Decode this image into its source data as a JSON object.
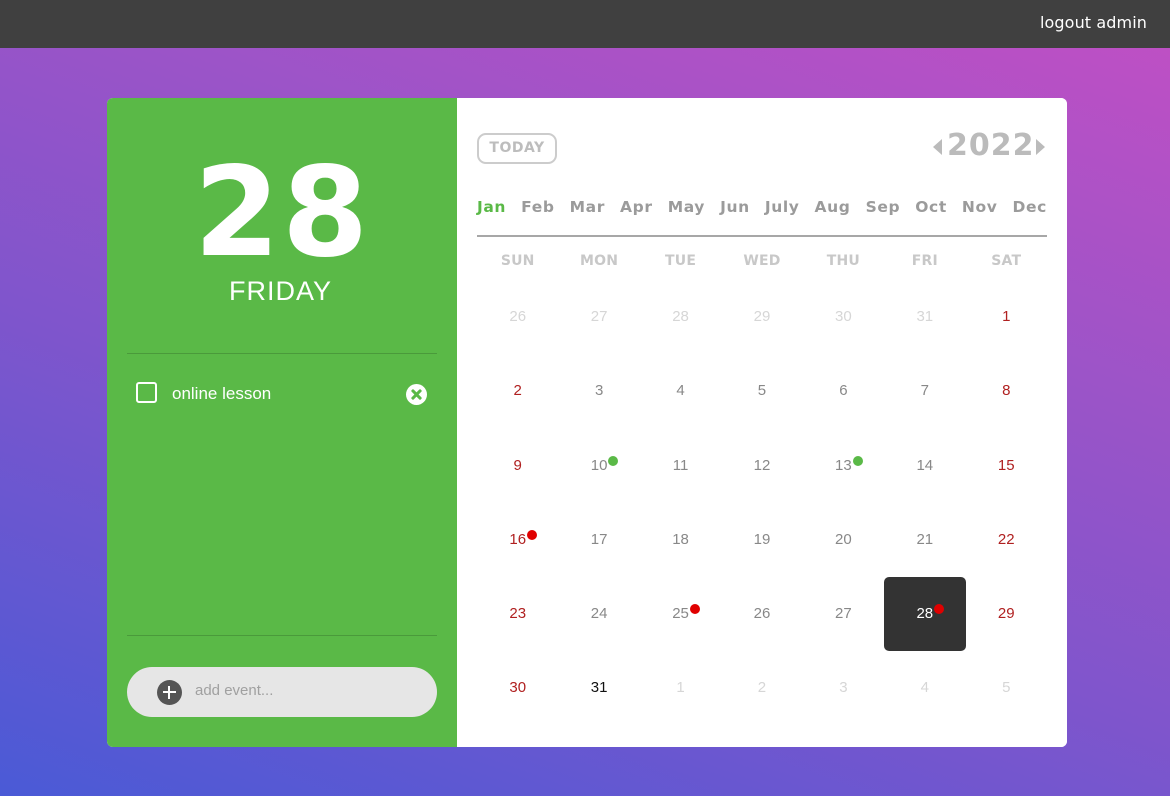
{
  "topbar": {
    "logout_label": "logout admin"
  },
  "sidebar": {
    "day_number": "28",
    "weekday": "FRIDAY",
    "events": [
      {
        "label": "online lesson",
        "checked": false
      }
    ],
    "add_placeholder": "add event..."
  },
  "calendar": {
    "today_label": "TODAY",
    "year": "2022",
    "months": [
      "Jan",
      "Feb",
      "Mar",
      "Apr",
      "May",
      "Jun",
      "July",
      "Aug",
      "Sep",
      "Oct",
      "Nov",
      "Dec"
    ],
    "active_month": "Jan",
    "weekdays": [
      "SUN",
      "MON",
      "TUE",
      "WED",
      "THU",
      "FRI",
      "SAT"
    ],
    "weeks": [
      [
        {
          "d": "26",
          "other": true
        },
        {
          "d": "27",
          "other": true
        },
        {
          "d": "28",
          "other": true
        },
        {
          "d": "29",
          "other": true
        },
        {
          "d": "30",
          "other": true
        },
        {
          "d": "31",
          "other": true
        },
        {
          "d": "1",
          "weekend": true
        }
      ],
      [
        {
          "d": "2",
          "weekend": true
        },
        {
          "d": "3"
        },
        {
          "d": "4"
        },
        {
          "d": "5"
        },
        {
          "d": "6"
        },
        {
          "d": "7"
        },
        {
          "d": "8",
          "weekend": true
        }
      ],
      [
        {
          "d": "9",
          "weekend": true
        },
        {
          "d": "10",
          "dot": "green"
        },
        {
          "d": "11"
        },
        {
          "d": "12"
        },
        {
          "d": "13",
          "dot": "green"
        },
        {
          "d": "14"
        },
        {
          "d": "15",
          "weekend": true
        }
      ],
      [
        {
          "d": "16",
          "weekend": true,
          "dot": "red"
        },
        {
          "d": "17"
        },
        {
          "d": "18"
        },
        {
          "d": "19"
        },
        {
          "d": "20"
        },
        {
          "d": "21"
        },
        {
          "d": "22",
          "weekend": true
        }
      ],
      [
        {
          "d": "23",
          "weekend": true
        },
        {
          "d": "24"
        },
        {
          "d": "25",
          "dot": "red"
        },
        {
          "d": "26"
        },
        {
          "d": "27"
        },
        {
          "d": "28",
          "selected": true,
          "dot": "red"
        },
        {
          "d": "29",
          "weekend": true
        }
      ],
      [
        {
          "d": "30",
          "weekend": true
        },
        {
          "d": "31",
          "dark": true
        },
        {
          "d": "1",
          "other": true
        },
        {
          "d": "2",
          "other": true
        },
        {
          "d": "3",
          "other": true
        },
        {
          "d": "4",
          "other": true
        },
        {
          "d": "5",
          "other": true
        }
      ]
    ]
  },
  "colors": {
    "accent_green": "#5ab947",
    "weekend_red": "#b02020",
    "event_dot_red": "#e00000",
    "topbar": "#404040",
    "selected_day": "#333333"
  }
}
